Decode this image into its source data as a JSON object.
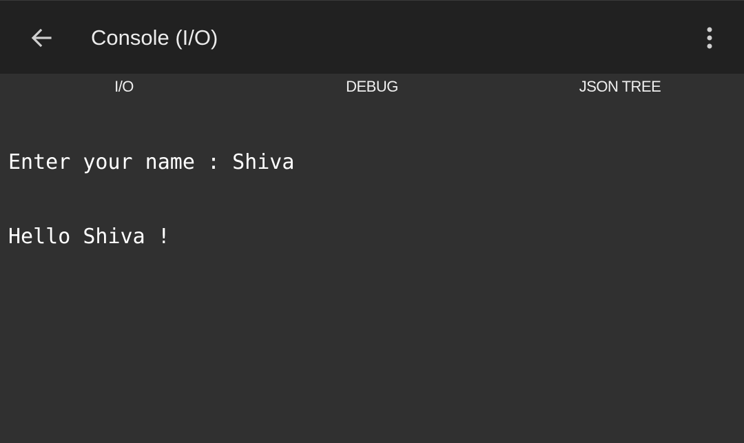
{
  "app_bar": {
    "back_icon": "arrow-left-icon",
    "title": "Console (I/O)",
    "overflow_icon": "more-vertical-icon",
    "background": "#212121"
  },
  "tabs": [
    {
      "label": "I/O"
    },
    {
      "label": "DEBUG"
    },
    {
      "label": "JSON TREE"
    }
  ],
  "console": {
    "lines": [
      "Enter your name : Shiva",
      "Hello Shiva !"
    ],
    "background": "#303030",
    "text_color": "#ffffff"
  }
}
